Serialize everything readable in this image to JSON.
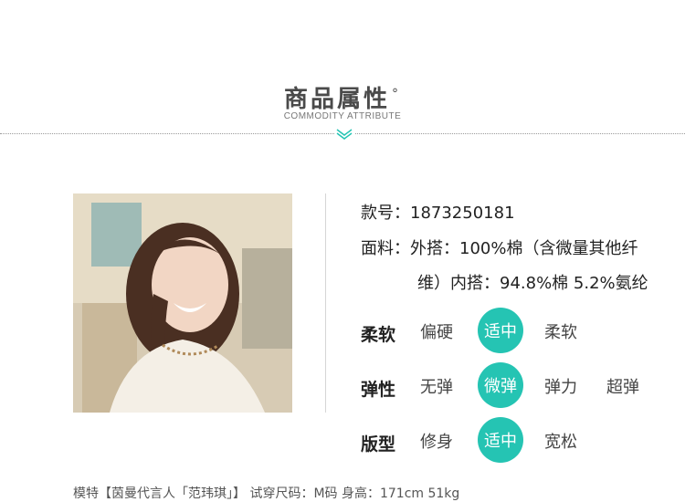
{
  "header": {
    "title": "商品属性",
    "degree_mark": "°",
    "subtitle": "COMMODITY ATTRIBUTE"
  },
  "product": {
    "model_line": "款号：1873250181",
    "fabric_line1": "面料：外搭：100%棉（含微量其他纤",
    "fabric_line2": "维）内搭：94.8%棉 5.2%氨纶"
  },
  "attributes": [
    {
      "label": "柔软",
      "options": [
        "偏硬",
        "适中",
        "柔软"
      ],
      "selected": "适中"
    },
    {
      "label": "弹性",
      "options": [
        "无弹",
        "微弹",
        "弹力",
        "超弹"
      ],
      "selected": "微弹"
    },
    {
      "label": "版型",
      "options": [
        "修身",
        "适中",
        "宽松"
      ],
      "selected": "适中"
    }
  ],
  "footer": {
    "text": "模特【茵曼代言人「范玮琪」】 试穿尺码：M码  身高：171cm 51kg"
  },
  "colors": {
    "accent": "#25c4b3",
    "text": "#222222",
    "muted": "#777777"
  }
}
